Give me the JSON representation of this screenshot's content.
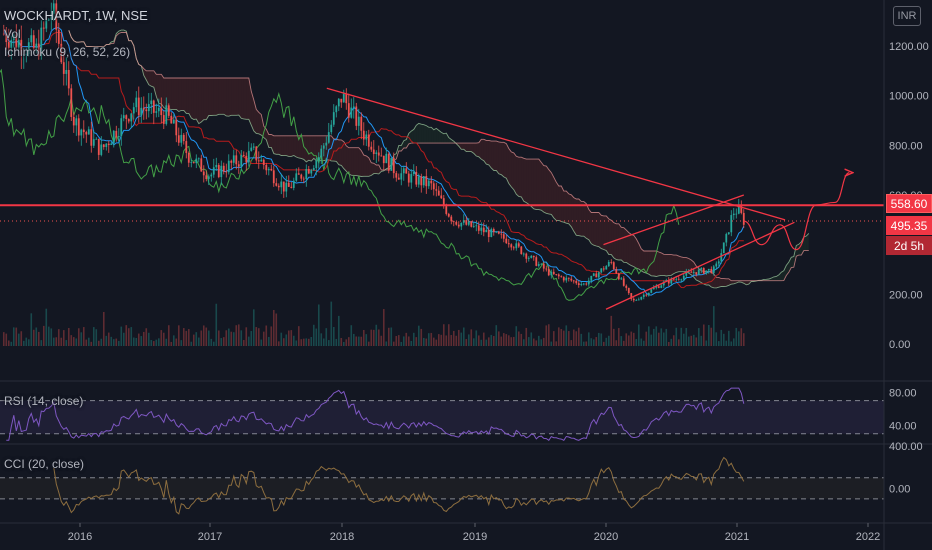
{
  "legend": {
    "title": "WOCKHARDT, 1W, NSE",
    "volume": "Vol",
    "ichimoku": "Ichimoku (9, 26, 52, 26)",
    "rsi": "RSI (14, close)",
    "cci": "CCI (20, close)"
  },
  "currency": "INR",
  "price_tags": {
    "hline": "558.60",
    "last": "495.35",
    "countdown": "2d 5h"
  },
  "colors": {
    "background": "#131722",
    "up_candle": "#26a69a",
    "down_candle": "#ef5350",
    "trendline": "#f23645",
    "tenkan": "#2196f3",
    "kijun": "#b71c1c",
    "chikou": "#43a047",
    "span_a": "#a5d6a7",
    "span_b": "#ef9a9a",
    "rsi_line": "#7e57c2",
    "cci_line": "#8d6e3f"
  },
  "chart_data": [
    {
      "type": "candlestick",
      "title": "WOCKHARDT, 1W, NSE",
      "x_tick_labels": [
        "2016",
        "2017",
        "2018",
        "2019",
        "2020",
        "2021",
        "2022"
      ],
      "y_tick_labels": [
        "1200.00",
        "1000.00",
        "800.00",
        "600.00",
        "200.00",
        "0.00"
      ],
      "ylim": [
        0,
        1250
      ],
      "grid": false,
      "close_path": [
        {
          "date": "2015-06-01",
          "value": 1250
        },
        {
          "date": "2015-09-01",
          "value": 1180
        },
        {
          "date": "2015-10-15",
          "value": 1350
        },
        {
          "date": "2015-12-15",
          "value": 900
        },
        {
          "date": "2016-03-01",
          "value": 780
        },
        {
          "date": "2016-06-01",
          "value": 960
        },
        {
          "date": "2016-09-01",
          "value": 920
        },
        {
          "date": "2016-11-01",
          "value": 760
        },
        {
          "date": "2017-01-01",
          "value": 680
        },
        {
          "date": "2017-05-01",
          "value": 770
        },
        {
          "date": "2017-08-01",
          "value": 620
        },
        {
          "date": "2017-11-01",
          "value": 760
        },
        {
          "date": "2018-01-01",
          "value": 1000
        },
        {
          "date": "2018-03-01",
          "value": 850
        },
        {
          "date": "2018-06-01",
          "value": 690
        },
        {
          "date": "2018-09-01",
          "value": 640
        },
        {
          "date": "2018-11-01",
          "value": 500
        },
        {
          "date": "2019-04-01",
          "value": 420
        },
        {
          "date": "2019-08-01",
          "value": 280
        },
        {
          "date": "2019-11-01",
          "value": 240
        },
        {
          "date": "2020-01-15",
          "value": 330
        },
        {
          "date": "2020-03-15",
          "value": 170
        },
        {
          "date": "2020-06-01",
          "value": 240
        },
        {
          "date": "2020-09-01",
          "value": 290
        },
        {
          "date": "2020-11-01",
          "value": 300
        },
        {
          "date": "2020-12-01",
          "value": 420
        },
        {
          "date": "2020-12-20",
          "value": 530
        },
        {
          "date": "2021-01-05",
          "value": 540
        },
        {
          "date": "2021-01-20",
          "value": 495.35
        }
      ],
      "horizontal_line": 558.6,
      "last_price": 495.35,
      "trendlines": [
        {
          "from": {
            "date": "2017-11-20",
            "value": 1030
          },
          "to": {
            "date": "2021-05-15",
            "value": 500
          }
        },
        {
          "from": {
            "date": "2020-01-01",
            "value": 140
          },
          "to": {
            "date": "2021-06-10",
            "value": 490
          }
        },
        {
          "from": {
            "date": "2019-12-25",
            "value": 400
          },
          "to": {
            "date": "2021-01-20",
            "value": 600
          }
        }
      ],
      "projection": [
        {
          "date": "2021-01-20",
          "value": 495
        },
        {
          "date": "2021-03-10",
          "value": 400
        },
        {
          "date": "2021-05-01",
          "value": 480
        },
        {
          "date": "2021-06-15",
          "value": 380
        },
        {
          "date": "2021-08-10",
          "value": 560
        },
        {
          "date": "2021-10-01",
          "value": 570
        },
        {
          "date": "2021-11-10",
          "value": 690
        }
      ]
    },
    {
      "type": "line",
      "title": "RSI (14, close)",
      "y_tick_labels": [
        "80.00",
        "40.00"
      ],
      "ylim": [
        20,
        90
      ],
      "bands": [
        70,
        30
      ]
    },
    {
      "type": "line",
      "title": "CCI (20, close)",
      "y_tick_labels": [
        "400.00",
        "0.00"
      ],
      "ylim": [
        -300,
        400
      ],
      "bands": [
        100,
        -100
      ]
    }
  ]
}
